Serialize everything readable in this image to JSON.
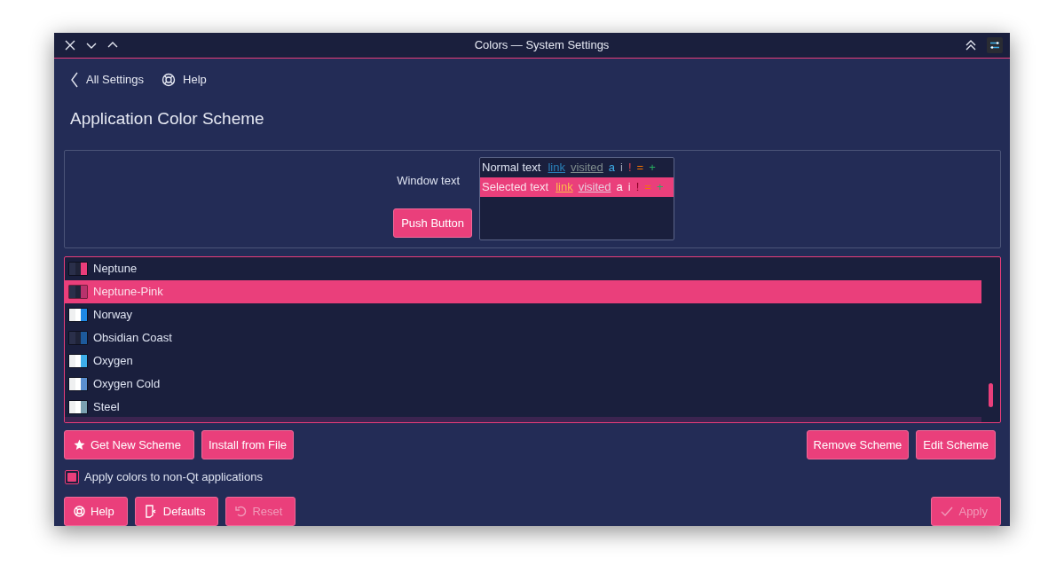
{
  "window": {
    "title": "Colors — System Settings"
  },
  "nav": {
    "back_label": "All Settings",
    "help_label": "Help"
  },
  "heading": "Application Color Scheme",
  "preview": {
    "label": "Window text",
    "button": "Push Button",
    "rows": [
      {
        "kind": "normal",
        "items": [
          {
            "kind": "text",
            "text": "Normal text"
          },
          {
            "kind": "link",
            "text": "link"
          },
          {
            "kind": "visited",
            "text": "visited"
          },
          {
            "kind": "active",
            "text": "a"
          },
          {
            "kind": "inactive",
            "text": "i"
          },
          {
            "kind": "negative",
            "text": "!"
          },
          {
            "kind": "neutral",
            "text": "="
          },
          {
            "kind": "positive",
            "text": "+"
          }
        ]
      },
      {
        "kind": "selected",
        "items": [
          {
            "kind": "text",
            "text": "Selected text"
          },
          {
            "kind": "link",
            "text": "link"
          },
          {
            "kind": "visited",
            "text": "visited"
          },
          {
            "kind": "active",
            "text": "a"
          },
          {
            "kind": "inactive",
            "text": "i"
          },
          {
            "kind": "negative",
            "text": "!"
          },
          {
            "kind": "neutral",
            "text": "="
          },
          {
            "kind": "positive",
            "text": "+"
          }
        ]
      }
    ]
  },
  "schemes": [
    {
      "name": "Neptune",
      "kind": "dark",
      "color": "#e93d7a",
      "selected": false
    },
    {
      "name": "Neptune-Pink",
      "kind": "dark",
      "color": "#b8326c",
      "selected": true
    },
    {
      "name": "Norway",
      "kind": "light",
      "color": "#1e88e5",
      "selected": false
    },
    {
      "name": "Obsidian Coast",
      "kind": "dark",
      "color": "#1d5a9b",
      "selected": false
    },
    {
      "name": "Oxygen",
      "kind": "light",
      "color": "#3daee9",
      "selected": false
    },
    {
      "name": "Oxygen Cold",
      "kind": "light",
      "color": "#5a8fd0",
      "selected": false
    },
    {
      "name": "Steel",
      "kind": "light",
      "color": "#7aa0b0",
      "selected": false
    }
  ],
  "scheme_buttons_left": [
    {
      "kind": "star",
      "label": "Get New Scheme"
    },
    {
      "kind": "plain",
      "label": "Install from File"
    }
  ],
  "scheme_buttons_right": [
    {
      "label": "Remove Scheme"
    },
    {
      "label": "Edit Scheme"
    }
  ],
  "apply_non_qt": {
    "label": "Apply colors to non-Qt applications",
    "checked": true
  },
  "footer_left": [
    {
      "kind": "help",
      "label": "Help",
      "disabled": false
    },
    {
      "kind": "defaults",
      "label": "Defaults",
      "disabled": false
    },
    {
      "kind": "reset",
      "label": "Reset",
      "disabled": true
    }
  ],
  "footer_right": [
    {
      "kind": "apply",
      "label": "Apply",
      "disabled": true
    }
  ]
}
